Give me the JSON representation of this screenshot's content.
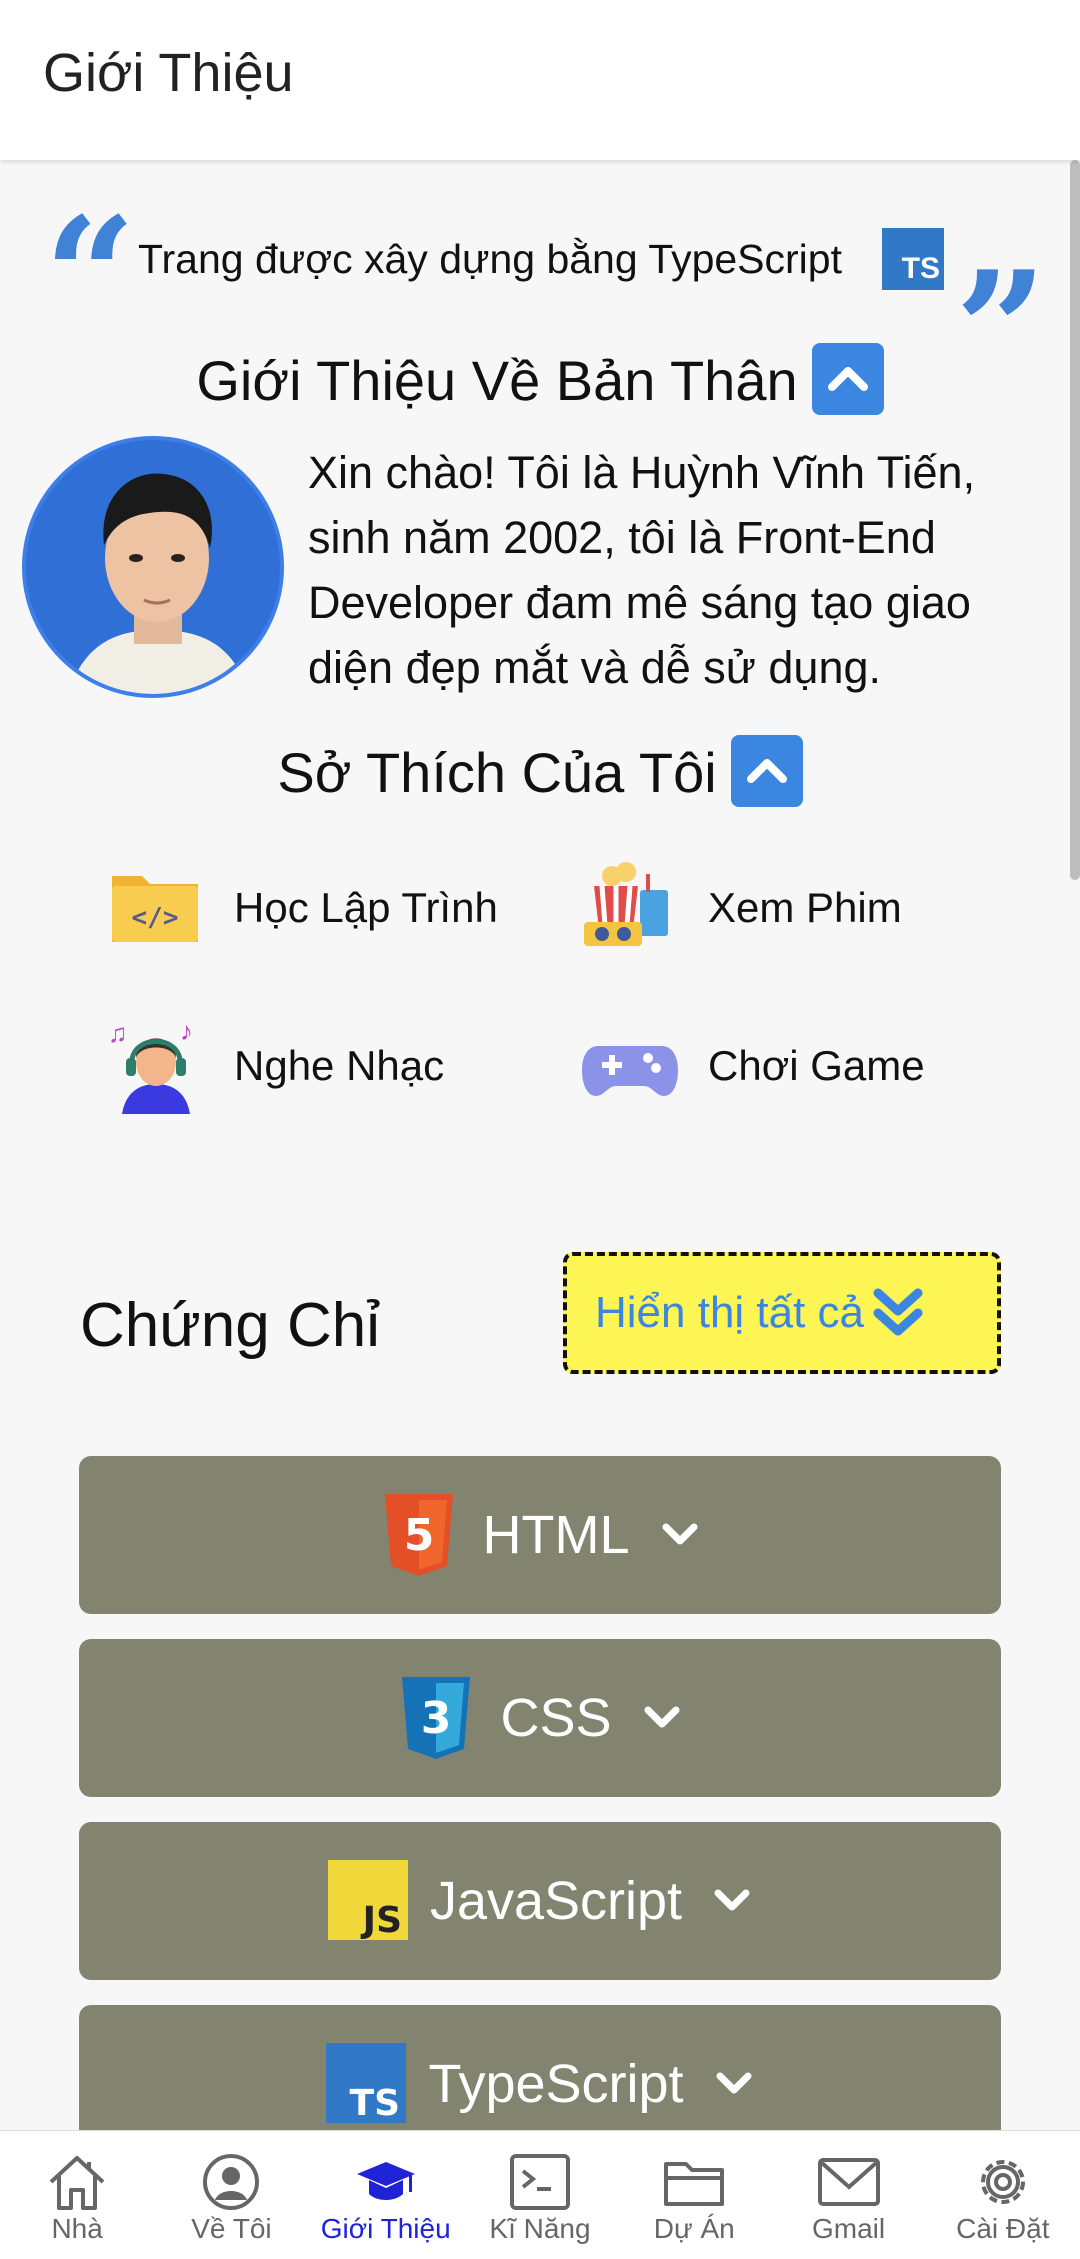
{
  "header": {
    "title": "Giới Thiệu"
  },
  "quote": {
    "open": "“",
    "close": "”",
    "text": "Trang được xây dựng bằng TypeScript",
    "ts_badge": "TS"
  },
  "about": {
    "heading": "Giới Thiệu Về Bản Thân",
    "text_before": "Xin chào! Tôi là ",
    "name": "Huỳnh Vĩnh Tiến",
    "text_after": ", sinh năm 2002, tôi là Front-End Developer đam mê sáng tạo giao diện đẹp mắt và dễ sử dụng."
  },
  "hobbies": {
    "heading": "Sở Thích Của Tôi",
    "items": [
      {
        "label": "Học Lập Trình",
        "icon": "code-folder-icon"
      },
      {
        "label": "Xem Phim",
        "icon": "movie-icon"
      },
      {
        "label": "Nghe Nhạc",
        "icon": "music-listener-icon"
      },
      {
        "label": "Chơi Game",
        "icon": "gamepad-icon"
      }
    ]
  },
  "certificates": {
    "heading": "Chứng Chỉ",
    "show_all": "Hiển thị tất cả",
    "items": [
      {
        "label": "HTML",
        "icon": "html5-icon",
        "badge": "5"
      },
      {
        "label": "CSS",
        "icon": "css3-icon",
        "badge": "3"
      },
      {
        "label": "JavaScript",
        "icon": "js-icon",
        "badge": "JS"
      },
      {
        "label": "TypeScript",
        "icon": "ts-icon",
        "badge": "TS"
      }
    ]
  },
  "nav": {
    "items": [
      {
        "label": "Nhà",
        "icon": "home-icon"
      },
      {
        "label": "Về Tôi",
        "icon": "user-circle-icon"
      },
      {
        "label": "Giới Thiệu",
        "icon": "graduation-cap-icon",
        "active": true
      },
      {
        "label": "Kĩ Năng",
        "icon": "terminal-icon"
      },
      {
        "label": "Dự Án",
        "icon": "folder-icon"
      },
      {
        "label": "Gmail",
        "icon": "mail-icon"
      },
      {
        "label": "Cài Đặt",
        "icon": "gear-icon"
      }
    ]
  },
  "colors": {
    "accent": "#3a86e0",
    "nav_active": "#1f22d6",
    "cert_bg": "#83846f",
    "show_all_bg": "#fcf553"
  }
}
